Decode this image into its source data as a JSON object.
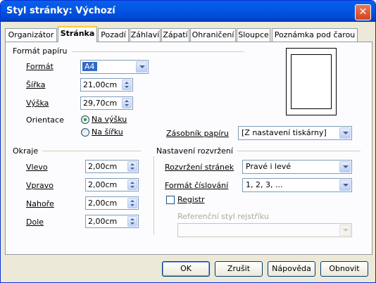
{
  "window": {
    "title": "Styl stránky: Výchozí",
    "close_label": "✕"
  },
  "tabs": [
    {
      "label": "Organizátor"
    },
    {
      "label": "Stránka"
    },
    {
      "label": "Pozadí"
    },
    {
      "label": "Záhlaví"
    },
    {
      "label": "Zápatí"
    },
    {
      "label": "Ohraničení"
    },
    {
      "label": "Sloupce"
    },
    {
      "label": "Poznámka pod čarou"
    }
  ],
  "paper_format": {
    "heading": "Formát papíru",
    "format_label": "Formát",
    "format_value": "A4",
    "width_label": "Šířka",
    "width_value": "21,00cm",
    "height_label": "Výška",
    "height_value": "29,70cm",
    "orientation_label": "Orientace",
    "portrait_label": "Na výšku",
    "landscape_label": "Na šířku",
    "portrait_selected": true,
    "paper_tray_label": "Zásobník papíru",
    "paper_tray_value": "[Z nastavení tiskárny]"
  },
  "margins": {
    "heading": "Okraje",
    "left_label": "Vlevo",
    "left_value": "2,00cm",
    "right_label": "Vpravo",
    "right_value": "2,00cm",
    "top_label": "Nahoře",
    "top_value": "2,00cm",
    "bottom_label": "Dole",
    "bottom_value": "2,00cm"
  },
  "layout": {
    "heading": "Nastavení rozvržení",
    "page_layout_label": "Rozvržení stránek",
    "page_layout_value": "Pravé i levé",
    "number_format_label": "Formát číslování",
    "number_format_value": "1, 2, 3, ...",
    "register_label": "Registr",
    "register_checked": false,
    "reference_style_label": "Referenční styl rejstříku",
    "reference_style_value": ""
  },
  "buttons": {
    "ok": "OK",
    "cancel": "Zrušit",
    "help": "Nápověda",
    "reset": "Obnovit"
  },
  "colors": {
    "titlebar": "#0058e5",
    "dialog_bg": "#ece9d8",
    "tab_accent": "#ffc83c"
  }
}
